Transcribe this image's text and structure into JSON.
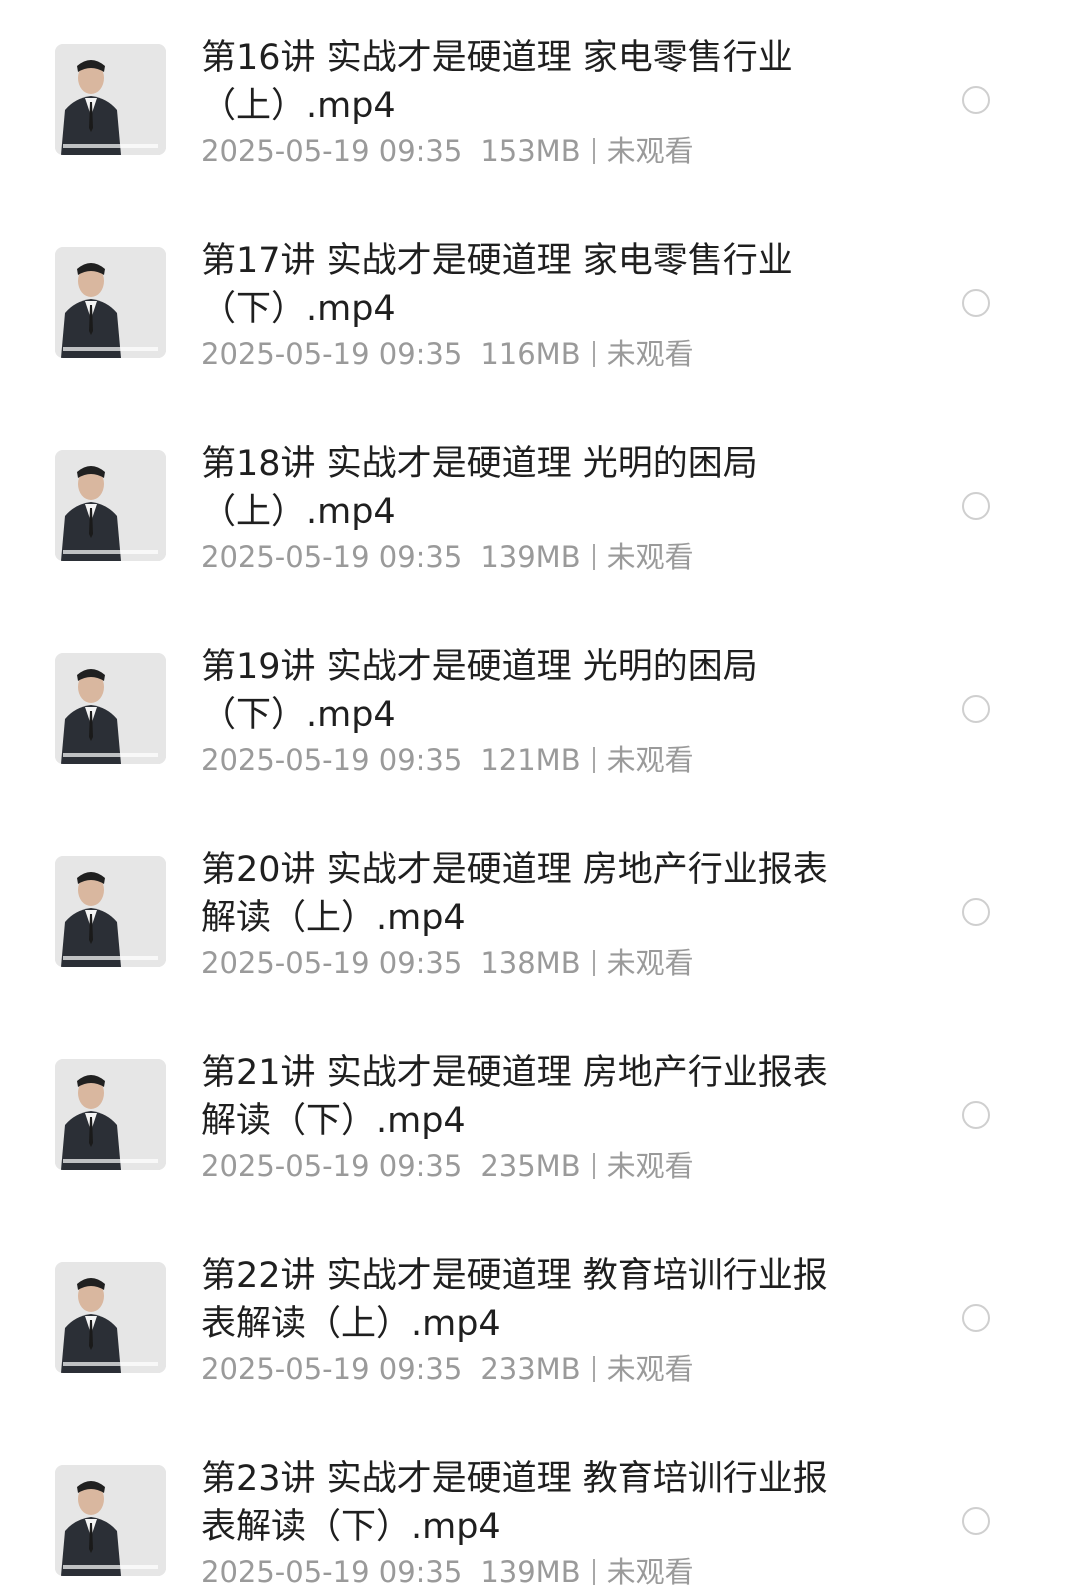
{
  "files": [
    {
      "title": "第16讲 实战才是硬道理 家电零售行业（上）.mp4",
      "date": "2025-05-19 09:35",
      "size": "153MB",
      "status": "未观看",
      "thumbnail": "video-thumbnail-icon"
    },
    {
      "title": "第17讲 实战才是硬道理 家电零售行业（下）.mp4",
      "date": "2025-05-19 09:35",
      "size": "116MB",
      "status": "未观看",
      "thumbnail": "video-thumbnail-icon"
    },
    {
      "title": "第18讲 实战才是硬道理 光明的困局（上）.mp4",
      "date": "2025-05-19 09:35",
      "size": "139MB",
      "status": "未观看",
      "thumbnail": "video-thumbnail-icon"
    },
    {
      "title": "第19讲 实战才是硬道理 光明的困局（下）.mp4",
      "date": "2025-05-19 09:35",
      "size": "121MB",
      "status": "未观看",
      "thumbnail": "video-thumbnail-icon"
    },
    {
      "title": "第20讲 实战才是硬道理 房地产行业报表解读（上）.mp4",
      "date": "2025-05-19 09:35",
      "size": "138MB",
      "status": "未观看",
      "thumbnail": "video-thumbnail-icon"
    },
    {
      "title": "第21讲 实战才是硬道理 房地产行业报表解读（下）.mp4",
      "date": "2025-05-19 09:35",
      "size": "235MB",
      "status": "未观看",
      "thumbnail": "video-thumbnail-icon"
    },
    {
      "title": "第22讲 实战才是硬道理 教育培训行业报表解读（上）.mp4",
      "date": "2025-05-19 09:35",
      "size": "233MB",
      "status": "未观看",
      "thumbnail": "video-thumbnail-icon"
    },
    {
      "title": "第23讲 实战才是硬道理 教育培训行业报表解读（下）.mp4",
      "date": "2025-05-19 09:35",
      "size": "139MB",
      "status": "未观看",
      "thumbnail": "video-thumbnail-icon"
    }
  ]
}
